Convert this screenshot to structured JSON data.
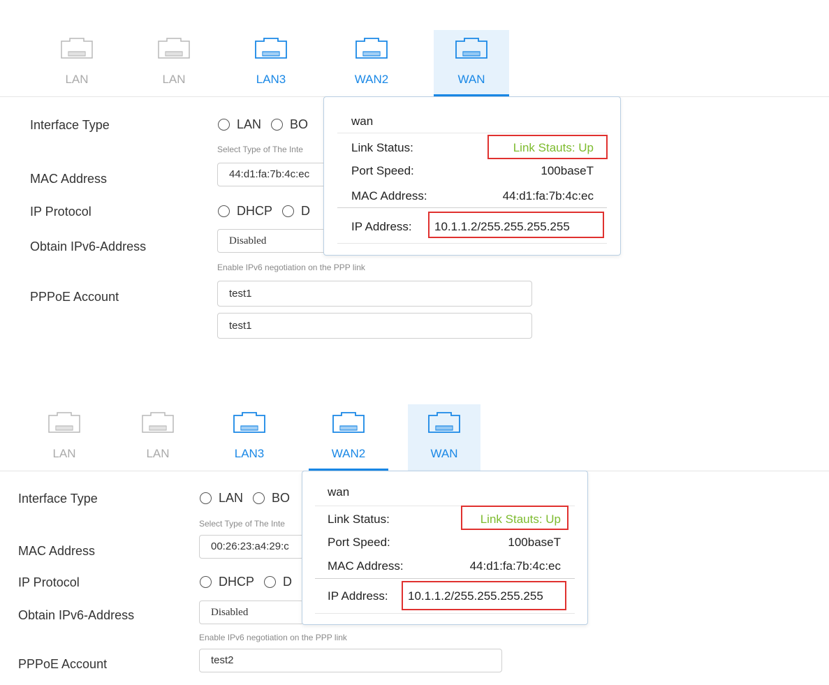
{
  "panels": [
    {
      "tabs": [
        {
          "label": "LAN",
          "state": "disabled"
        },
        {
          "label": "LAN",
          "state": "disabled"
        },
        {
          "label": "LAN3",
          "state": "enabled"
        },
        {
          "label": "WAN2",
          "state": "enabled"
        },
        {
          "label": "WAN",
          "state": "selected"
        }
      ],
      "form": {
        "interface_type_label": "Interface Type",
        "interface_type_options": [
          "LAN",
          "BO"
        ],
        "interface_type_hint": "Select Type of The Inte",
        "mac_label": "MAC Address",
        "mac_value": "44:d1:fa:7b:4c:ec",
        "ip_protocol_label": "IP Protocol",
        "ip_protocol_options": [
          "DHCP",
          "D"
        ],
        "ipv6_label": "Obtain IPv6-Address",
        "ipv6_value": "Disabled",
        "ipv6_hint": "Enable IPv6 negotiation on the PPP link",
        "pppoe_label": "PPPoE Account",
        "pppoe_value": "test1",
        "pppoe_value2": "test1"
      },
      "popup": {
        "title": "wan",
        "link_status_label": "Link Status:",
        "link_status_value": "Link Stauts: Up",
        "port_speed_label": "Port Speed:",
        "port_speed_value": "100baseT",
        "mac_label": "MAC Address:",
        "mac_value": "44:d1:fa:7b:4c:ec",
        "ip_label": "IP Address:",
        "ip_value": "10.1.1.2/255.255.255.255"
      }
    },
    {
      "tabs": [
        {
          "label": "LAN",
          "state": "disabled"
        },
        {
          "label": "LAN",
          "state": "disabled"
        },
        {
          "label": "LAN3",
          "state": "enabled"
        },
        {
          "label": "WAN2",
          "state": "active"
        },
        {
          "label": "WAN",
          "state": "highlighted"
        }
      ],
      "form": {
        "interface_type_label": "Interface Type",
        "interface_type_options": [
          "LAN",
          "BO"
        ],
        "interface_type_hint": "Select Type of The Inte",
        "mac_label": "MAC Address",
        "mac_value": "00:26:23:a4:29:c",
        "ip_protocol_label": "IP Protocol",
        "ip_protocol_options": [
          "DHCP",
          "D"
        ],
        "ipv6_label": "Obtain IPv6-Address",
        "ipv6_value": "Disabled",
        "ipv6_hint": "Enable IPv6 negotiation on the PPP link",
        "pppoe_label": "PPPoE Account",
        "pppoe_value": "test2"
      },
      "popup": {
        "title": "wan",
        "link_status_label": "Link Status:",
        "link_status_value": "Link Stauts: Up",
        "port_speed_label": "Port Speed:",
        "port_speed_value": "100baseT",
        "mac_label": "MAC Address:",
        "mac_value": "44:d1:fa:7b:4c:ec",
        "ip_label": "IP Address:",
        "ip_value": "10.1.1.2/255.255.255.255"
      }
    }
  ],
  "colors": {
    "accent": "#1a88e6",
    "status_up": "#7dbb2e",
    "highlight_box": "#e0312f",
    "disabled": "#aaaaaa"
  },
  "icons": {
    "port": "ethernet-port-icon"
  }
}
